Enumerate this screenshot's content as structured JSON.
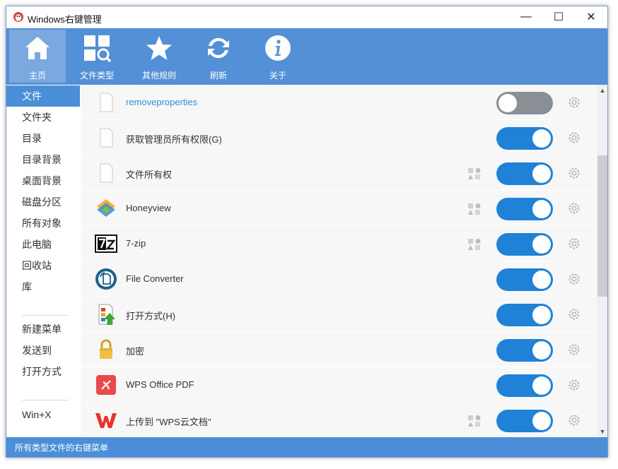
{
  "window": {
    "title": "Windows右键管理",
    "minimize_glyph": "—",
    "maximize_glyph": "☐",
    "close_glyph": "✕"
  },
  "toolbar": {
    "items": [
      {
        "label": "主页",
        "icon": "home-icon",
        "active": true
      },
      {
        "label": "文件类型",
        "icon": "grid-search-icon",
        "active": false
      },
      {
        "label": "其他规则",
        "icon": "star-icon",
        "active": false
      },
      {
        "label": "刷新",
        "icon": "refresh-icon",
        "active": false
      },
      {
        "label": "关于",
        "icon": "info-icon",
        "active": false
      }
    ]
  },
  "sidebar": {
    "items": [
      {
        "label": "文件",
        "active": true
      },
      {
        "label": "文件夹"
      },
      {
        "label": "目录"
      },
      {
        "label": "目录背景"
      },
      {
        "label": "桌面背景"
      },
      {
        "label": "磁盘分区"
      },
      {
        "label": "所有对象"
      },
      {
        "label": "此电脑"
      },
      {
        "label": "回收站"
      },
      {
        "label": "库"
      },
      {
        "label": "新建菜单"
      },
      {
        "label": "发送到"
      },
      {
        "label": "打开方式"
      },
      {
        "label": "Win+X"
      }
    ]
  },
  "entries": [
    {
      "label": "removeproperties",
      "icon": "blank-file-icon",
      "enabled": false,
      "shapes": false,
      "link": true
    },
    {
      "label": "获取管理员所有权限(G)",
      "icon": "blank-file-icon",
      "enabled": true,
      "shapes": false
    },
    {
      "label": "文件所有权",
      "icon": "blank-file-icon",
      "enabled": true,
      "shapes": true
    },
    {
      "label": "Honeyview",
      "icon": "honeyview-icon",
      "enabled": true,
      "shapes": true
    },
    {
      "label": "7-zip",
      "icon": "7zip-icon",
      "enabled": true,
      "shapes": true
    },
    {
      "label": "File Converter",
      "icon": "file-converter-icon",
      "enabled": true,
      "shapes": false
    },
    {
      "label": "打开方式(H)",
      "icon": "open-with-icon",
      "enabled": true,
      "shapes": false
    },
    {
      "label": "加密",
      "icon": "lock-icon",
      "enabled": true,
      "shapes": false
    },
    {
      "label": "WPS Office PDF",
      "icon": "wps-pdf-icon",
      "enabled": true,
      "shapes": false
    },
    {
      "label": "上传到 \"WPS云文档\"",
      "icon": "wps-cloud-icon",
      "enabled": true,
      "shapes": true
    }
  ],
  "colors": {
    "accent": "#5390d6",
    "toggle_on": "#1f82d6",
    "toggle_off": "#8a8f96",
    "link": "#2d8fce"
  },
  "statusbar": {
    "text": "所有类型文件的右键菜单"
  }
}
